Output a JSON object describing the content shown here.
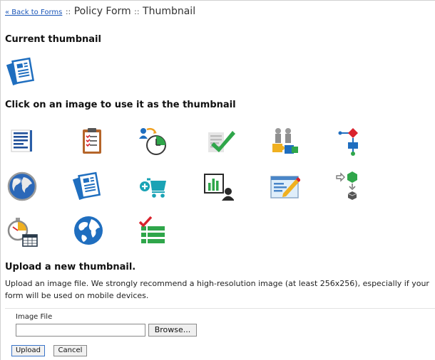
{
  "breadcrumb": {
    "back_link": "« Back to Forms",
    "separator": "::",
    "form_name": "Policy Form",
    "page": "Thumbnail"
  },
  "current_section": {
    "heading": "Current thumbnail",
    "icon": "document-stack-icon"
  },
  "gallery": {
    "heading": "Click on an image to use it as the thumbnail",
    "icons": [
      "text-lines-icon",
      "clipboard-icon",
      "user-timer-icon",
      "checkmark-document-icon",
      "puzzle-people-icon",
      "flowchart-icon",
      "globe-icon",
      "document-stack-icon",
      "shopping-cart-icon",
      "bar-chart-person-icon",
      "edit-window-icon",
      "workflow-icon",
      "stopwatch-calendar-icon",
      "world-icon",
      "checklist-icon"
    ]
  },
  "upload": {
    "heading": "Upload a new thumbnail.",
    "description": "Upload an image file. We strongly recommend a high-resolution image (at least 256x256), especially if your form will be used on mobile devices.",
    "file_label": "Image File",
    "file_value": "",
    "browse_label": "Browse...",
    "upload_label": "Upload",
    "cancel_label": "Cancel"
  },
  "colors": {
    "blue": "#1f6ebf",
    "green": "#2fa64a",
    "red": "#d9232d",
    "link": "#1a56b8"
  }
}
